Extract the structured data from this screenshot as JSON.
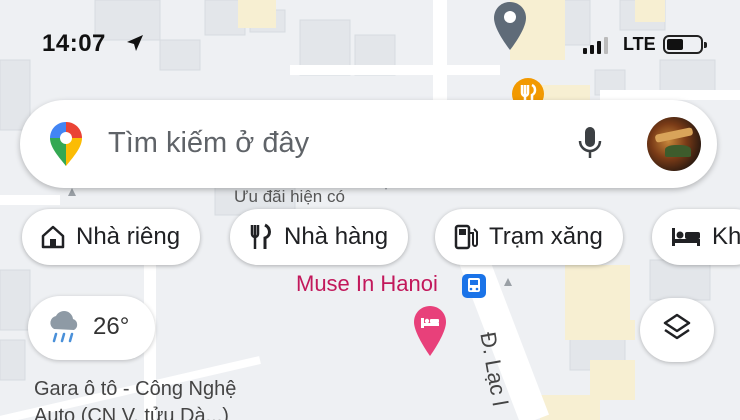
{
  "status_bar": {
    "time": "14:07",
    "network": "LTE",
    "icons": [
      "location-arrow-icon",
      "signal-icon",
      "battery-icon"
    ]
  },
  "search": {
    "placeholder": "Tìm kiếm ở đây",
    "icons": [
      "maps-logo-icon",
      "mic-icon",
      "avatar"
    ]
  },
  "map_labels": {
    "offer": "Ưu đãi hiện có",
    "muse": "Muse In Hanoi",
    "street": "Đ. Lạc l",
    "poi_line1": "Gara ô tô - Công Nghệ",
    "poi_line2": "Auto (CN V. tửu Dà...)"
  },
  "chips": [
    {
      "label": "Nhà riêng",
      "icon": "home-icon"
    },
    {
      "label": "Nhà hàng",
      "icon": "restaurant-icon"
    },
    {
      "label": "Trạm xăng",
      "icon": "gas-station-icon"
    },
    {
      "label": "Kh",
      "icon": "hotel-bed-icon"
    }
  ],
  "weather": {
    "temperature": "26°",
    "icon": "rain-cloud-icon"
  },
  "colors": {
    "accent_pink": "#c2185b",
    "bus_blue": "#1a73e8",
    "food_orange": "#f29900",
    "map_bg": "#eef0f3"
  }
}
